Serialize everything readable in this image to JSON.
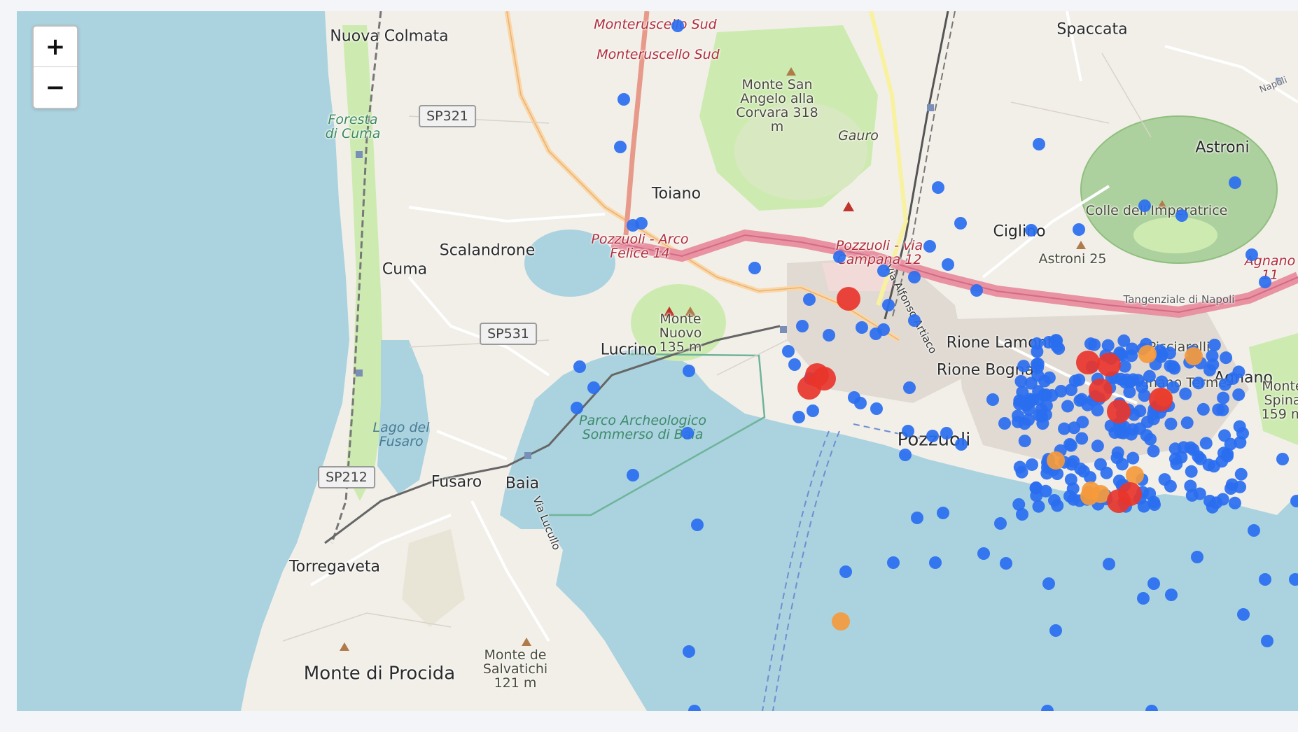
{
  "map": {
    "zoom_in_label": "+",
    "zoom_out_label": "−",
    "colors": {
      "sea": "#aad3df",
      "land": "#f2efe9",
      "green": "#cdebb0",
      "crater": "#add19e",
      "motorway": "#e892a2",
      "trunk": "#fcd6a4",
      "marker_low": "#2a6ef0",
      "marker_mid": "#f59a3c",
      "marker_high": "#e8352d"
    },
    "labels": {
      "town": [
        "Nuova Colmata",
        "Toiano",
        "Scalandrone",
        "Cuma",
        "Lucrino",
        "Fusaro",
        "Baia",
        "Torregaveta",
        "Ciglino",
        "Astroni",
        "Pozzuoli",
        "Rione Lamont",
        "Rione Bognar",
        "Spaccata",
        "Agnano",
        "Monte di Procida"
      ],
      "peak": [
        "Monte San Angelo alla Corvara 318 m",
        "Monte Nuovo 135 m",
        "Monte de Salvatichi 121 m",
        "Astroni 25",
        "Monte Spina 159 m",
        "Gauro",
        "Colle dell'Imperatrice",
        "Pisciarelli",
        "Agnano Terme"
      ],
      "green": [
        "Foresta di Cuma"
      ],
      "water": [
        "Lago del Fusaro",
        "Parco Archeologico Sommerso di Baia"
      ],
      "station": [
        "Monteruscello Sud",
        "Monteruscello Sud",
        "Pozzuoli - Arco Felice 14",
        "Pozzuoli - via Campana 12",
        "Tangenziale di Napoli",
        "Agnano 11"
      ],
      "road": [
        "SP321",
        "SP531",
        "SP212",
        "Via Alfonso Artiaco",
        "Via Lucullo",
        "Napoli"
      ]
    },
    "markers": {
      "count": 350,
      "categories": [
        "low",
        "mid",
        "high"
      ]
    }
  }
}
